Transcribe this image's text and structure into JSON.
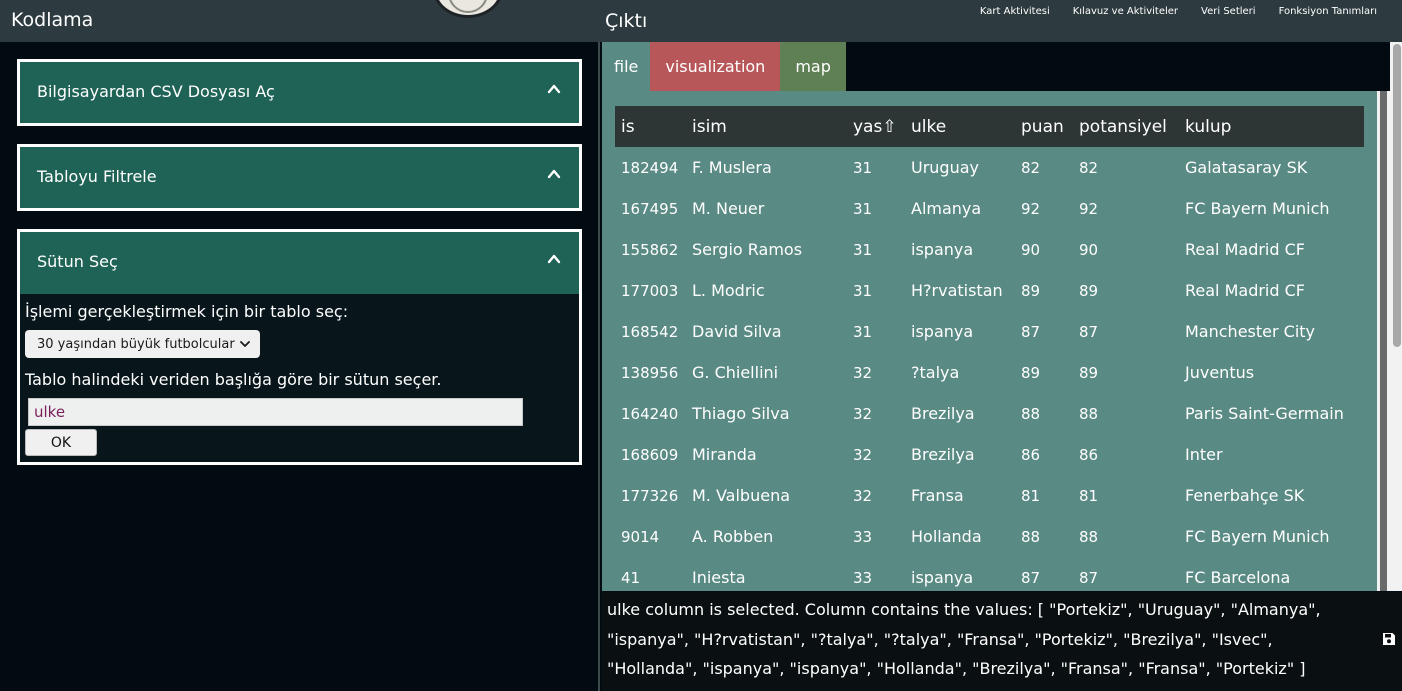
{
  "header": {
    "left_title": "Kodlama",
    "right_title": "Çıktı",
    "nav": [
      "Kart Aktivitesi",
      "Kılavuz ve Aktiviteler",
      "Veri Setleri",
      "Fonksiyon Tanımları"
    ]
  },
  "left": {
    "accordions": [
      {
        "title": "Bilgisayardan CSV Dosyası Aç"
      },
      {
        "title": "Tabloyu Filtrele"
      },
      {
        "title": "Sütun Seç"
      }
    ],
    "sutun": {
      "prompt": "İşlemi gerçekleştirmek için bir tablo seç:",
      "selected_table": "30 yaşından büyük futbolcular",
      "instruction": "Tablo halindeki veriden başlığa göre bir sütun seçer.",
      "column_value": "ulke",
      "ok_label": "OK"
    }
  },
  "output": {
    "tabs": [
      "file",
      "visualization",
      "map"
    ],
    "table": {
      "headers": [
        "is",
        "isim",
        "yas⇧",
        "ulke",
        "puan",
        "potansiyel",
        "kulup"
      ],
      "rows": [
        [
          "182494",
          "F. Muslera",
          "31",
          "Uruguay",
          "82",
          "82",
          "Galatasaray SK"
        ],
        [
          "167495",
          "M. Neuer",
          "31",
          "Almanya",
          "92",
          "92",
          "FC Bayern Munich"
        ],
        [
          "155862",
          "Sergio Ramos",
          "31",
          "ispanya",
          "90",
          "90",
          "Real Madrid CF"
        ],
        [
          "177003",
          "L. Modric",
          "31",
          "H?rvatistan",
          "89",
          "89",
          "Real Madrid CF"
        ],
        [
          "168542",
          "David Silva",
          "31",
          "ispanya",
          "87",
          "87",
          "Manchester City"
        ],
        [
          "138956",
          "G. Chiellini",
          "32",
          "?talya",
          "89",
          "89",
          "Juventus"
        ],
        [
          "164240",
          "Thiago Silva",
          "32",
          "Brezilya",
          "88",
          "88",
          "Paris Saint-Germain"
        ],
        [
          "168609",
          "Miranda",
          "32",
          "Brezilya",
          "86",
          "86",
          "Inter"
        ],
        [
          "177326",
          "M. Valbuena",
          "32",
          "Fransa",
          "81",
          "81",
          "Fenerbahçe SK"
        ],
        [
          "9014",
          "A. Robben",
          "33",
          "Hollanda",
          "88",
          "88",
          "FC Bayern Munich"
        ],
        [
          "41",
          "Iniesta",
          "33",
          "ispanya",
          "87",
          "87",
          "FC Barcelona"
        ]
      ]
    },
    "console_text": "ulke column is selected. Column contains the values: [ \"Portekiz\", \"Uruguay\", \"Almanya\", \"ispanya\", \"H?rvatistan\", \"?talya\", \"?talya\", \"Fransa\", \"Portekiz\", \"Brezilya\", \"Isvec\", \"Hollanda\", \"ispanya\", \"ispanya\", \"Hollanda\", \"Brezilya\", \"Fransa\", \"Fransa\", \"Portekiz\" ]"
  }
}
